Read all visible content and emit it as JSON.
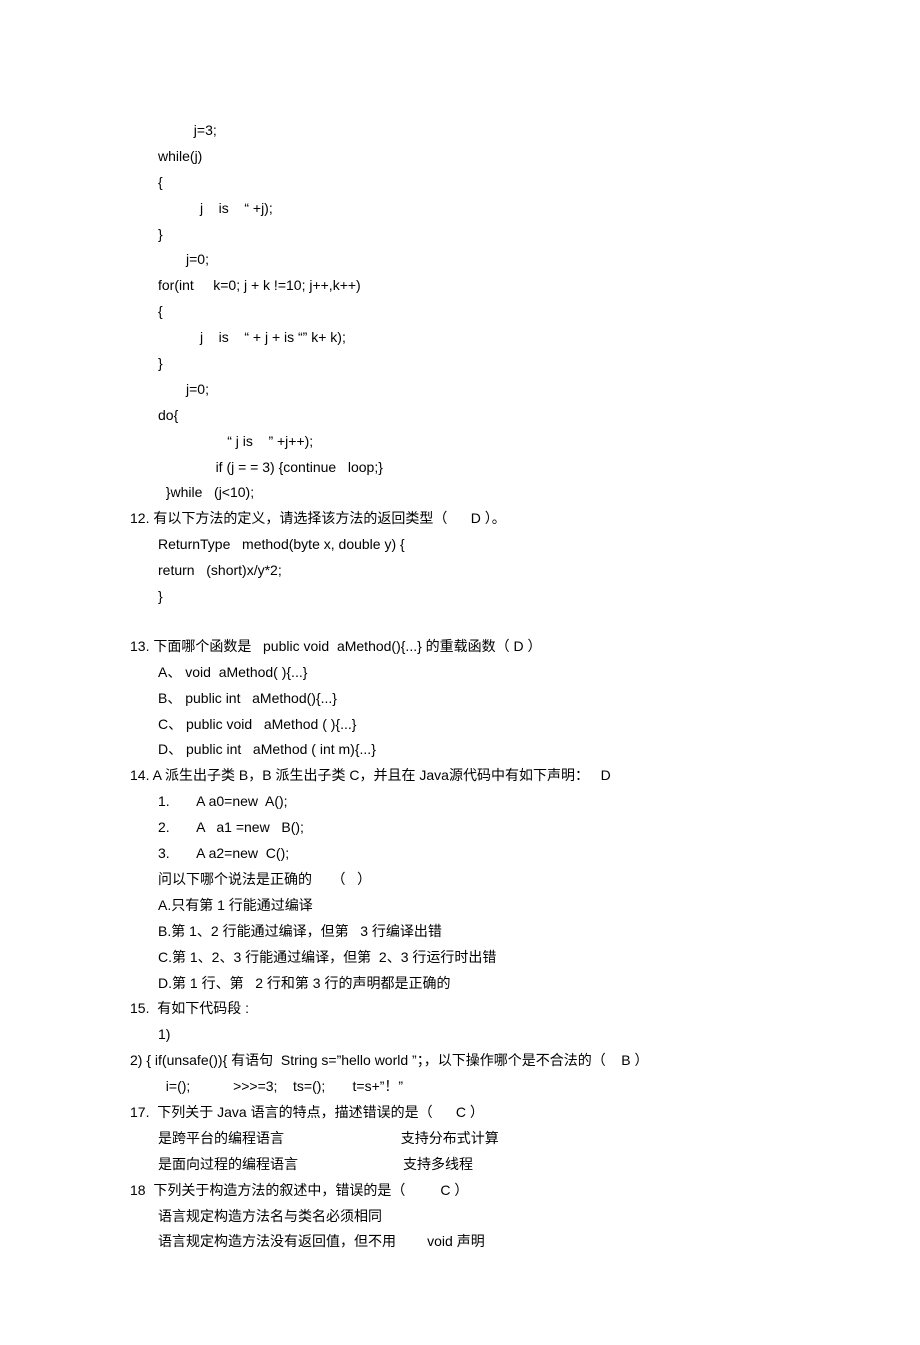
{
  "lines": [
    {
      "cls": "indent-2",
      "text": "  j=3;"
    },
    {
      "cls": "indent-1",
      "text": "while(j)"
    },
    {
      "cls": "indent-1",
      "text": "{"
    },
    {
      "cls": "indent-3",
      "text": "j    is    “ +j);"
    },
    {
      "cls": "indent-1",
      "text": "}"
    },
    {
      "cls": "indent-2",
      "text": "j=0;"
    },
    {
      "cls": "indent-1",
      "text": "for(int     k=0; j + k !=10; j++,k++)"
    },
    {
      "cls": "indent-1",
      "text": "{"
    },
    {
      "cls": "indent-3",
      "text": "j    is    “ + j + is “” k+ k);"
    },
    {
      "cls": "indent-1",
      "text": "}"
    },
    {
      "cls": "indent-2",
      "text": "j=0;"
    },
    {
      "cls": "indent-1",
      "text": "do{"
    },
    {
      "cls": "indent-3",
      "text": "       “ j is    ” +j++);"
    },
    {
      "cls": "indent-3",
      "text": "    if (j = = 3) {continue   loop;}"
    },
    {
      "cls": "indent-1",
      "text": "  }while   (j<10);"
    },
    {
      "cls": "",
      "text": "12. 有以下方法的定义，请选择该方法的返回类型（      D ）。"
    },
    {
      "cls": "indent-1",
      "text": "ReturnType   method(byte x, double y) {"
    },
    {
      "cls": "indent-1",
      "text": "return   (short)x/y*2;"
    },
    {
      "cls": "indent-1",
      "text": "}"
    },
    {
      "cls": "spacer",
      "text": ""
    },
    {
      "cls": "",
      "text": "13. 下面哪个函数是   public void  aMethod(){...} 的重载函数（ D ）"
    },
    {
      "cls": "indent-1",
      "text": "A、 void  aMethod( ){...}"
    },
    {
      "cls": "indent-1",
      "text": "B、 public int   aMethod(){...}"
    },
    {
      "cls": "indent-1",
      "text": "C、 public void   aMethod ( ){...}"
    },
    {
      "cls": "indent-1",
      "text": "D、 public int   aMethod ( int m){...}"
    },
    {
      "cls": "",
      "text": "14. A 派生出子类 B，B 派生出子类 C，并且在 Java源代码中有如下声明：   D"
    },
    {
      "cls": "indent-1",
      "text": "1.       A a0=new  A();"
    },
    {
      "cls": "indent-1",
      "text": "2.       A   a1 =new   B();"
    },
    {
      "cls": "indent-1",
      "text": "3.       A a2=new  C();"
    },
    {
      "cls": "indent-1",
      "text": "问以下哪个说法是正确的     （   ）"
    },
    {
      "cls": "indent-1",
      "text": "A.只有第 1 行能通过编译"
    },
    {
      "cls": "indent-1",
      "text": "B.第 1、2 行能通过编译，但第   3 行编译出错"
    },
    {
      "cls": "indent-1",
      "text": "C.第 1、2、3 行能通过编译，但第  2、3 行运行时出错"
    },
    {
      "cls": "indent-1",
      "text": "D.第 1 行、第   2 行和第 3 行的声明都是正确的"
    },
    {
      "cls": "",
      "text": "15.  有如下代码段 :"
    },
    {
      "cls": "indent-1",
      "text": "1)"
    },
    {
      "cls": "",
      "text": "2) { if(unsafe()){ 有语句  String s=”hello world ”；，以下操作哪个是不合法的（    B ）"
    },
    {
      "cls": "indent-1",
      "text": "  i=();           >>>=3;    ts=();       t=s+”！”"
    },
    {
      "cls": "",
      "text": "17.  下列关于 Java 语言的特点，描述错误的是（      C ）"
    },
    {
      "cls": "indent-1",
      "text": "是跨平台的编程语言                              支持分布式计算"
    },
    {
      "cls": "indent-1",
      "text": "是面向过程的编程语言                           支持多线程"
    },
    {
      "cls": "",
      "text": "18  下列关于构造方法的叙述中，错误的是（         C ）"
    },
    {
      "cls": "indent-1",
      "text": "语言规定构造方法名与类名必须相同"
    },
    {
      "cls": "indent-1",
      "text": "语言规定构造方法没有返回值，但不用        void 声明"
    }
  ]
}
